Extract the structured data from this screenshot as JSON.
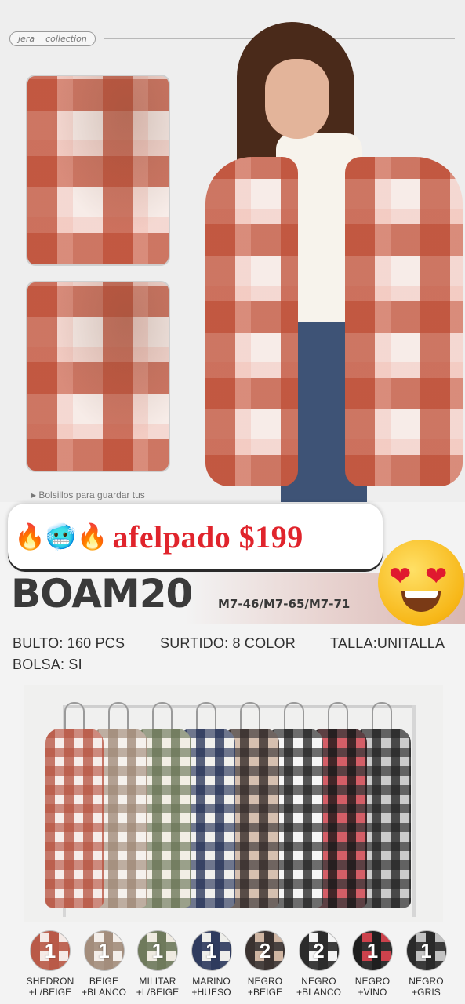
{
  "brand": {
    "word1": "jera",
    "word2": "collection"
  },
  "hero": {
    "caption": "▸ Bolsillos para guardar tus"
  },
  "promo": {
    "fire_emoji": "🔥",
    "cold_emoji": "🥶",
    "price_text": "afelpado $199",
    "love_emoji": "😍"
  },
  "product": {
    "code": "BOAM20",
    "variants": "M7-46/M7-65/M7-71"
  },
  "specs": {
    "bulto": "BULTO: 160 PCS",
    "surtido": "SURTIDO: 8 COLOR",
    "talla": "TALLA:UNITALLA",
    "bolsa": "BOLSA: SI"
  },
  "colors": [
    {
      "qty": "1",
      "line1": "SHEDRON",
      "line2": "+L/BEIGE",
      "primary": "#b95a48",
      "secondary": "#f3e6e2"
    },
    {
      "qty": "1",
      "line1": "BEIGE",
      "line2": "+BLANCO",
      "primary": "#a38d7c",
      "secondary": "#f1ece6"
    },
    {
      "qty": "1",
      "line1": "MILITAR",
      "line2": "+L/BEIGE",
      "primary": "#6f7a5c",
      "secondary": "#ede7dc"
    },
    {
      "qty": "1",
      "line1": "MARINO",
      "line2": "+HUESO",
      "primary": "#2f3b5e",
      "secondary": "#ecebe6"
    },
    {
      "qty": "2",
      "line1": "NEGRO",
      "line2": "+BEIGE",
      "primary": "#3a3230",
      "secondary": "#c7a892"
    },
    {
      "qty": "2",
      "line1": "NEGRO",
      "line2": "+BLANCO",
      "primary": "#2c2c2c",
      "secondary": "#f2f2f2"
    },
    {
      "qty": "1",
      "line1": "NEGRO",
      "line2": "+VINO",
      "primary": "#1f1f1f",
      "secondary": "#c3212d"
    },
    {
      "qty": "1",
      "line1": "NEGRO",
      "line2": "+GRIS",
      "primary": "#2a2a2a",
      "secondary": "#b7b7b7"
    }
  ]
}
